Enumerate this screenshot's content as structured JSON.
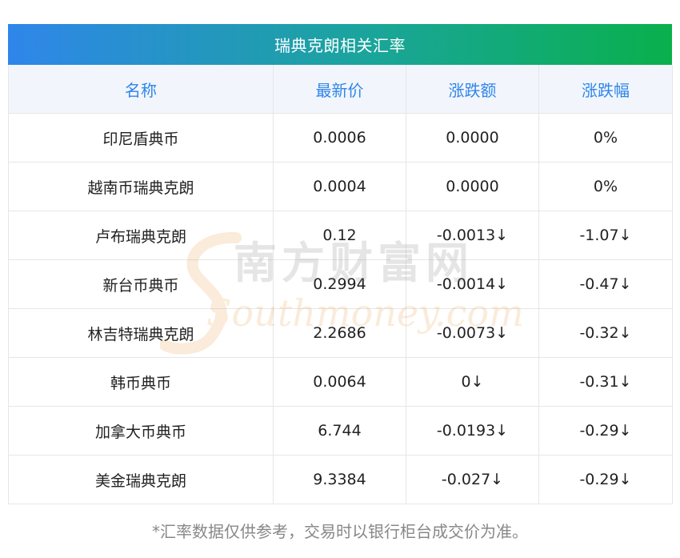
{
  "title": "瑞典克朗相关汇率",
  "columns": [
    "名称",
    "最新价",
    "涨跌额",
    "涨跌幅"
  ],
  "rows": [
    {
      "name": "印尼盾典币",
      "price": "0.0006",
      "change": "0.0000",
      "pct": "0%",
      "down": false
    },
    {
      "name": "越南币瑞典克朗",
      "price": "0.0004",
      "change": "0.0000",
      "pct": "0%",
      "down": false
    },
    {
      "name": "卢布瑞典克朗",
      "price": "0.12",
      "change": "-0.0013↓",
      "pct": "-1.07↓",
      "down": true
    },
    {
      "name": "新台币典币",
      "price": "0.2994",
      "change": "-0.0014↓",
      "pct": "-0.47↓",
      "down": true
    },
    {
      "name": "林吉特瑞典克朗",
      "price": "2.2686",
      "change": "-0.0073↓",
      "pct": "-0.32↓",
      "down": true
    },
    {
      "name": "韩币典币",
      "price": "0.0064",
      "change": "0↓",
      "pct": "-0.31↓",
      "down": true
    },
    {
      "name": "加拿大币典币",
      "price": "6.744",
      "change": "-0.0193↓",
      "pct": "-0.29↓",
      "down": true
    },
    {
      "name": "美金瑞典克朗",
      "price": "9.3384",
      "change": "-0.027↓",
      "pct": "-0.29↓",
      "down": true
    }
  ],
  "watermark": {
    "brand_cn": "南方财富网",
    "brand_en": "Southmoney.com"
  },
  "footnote": "*汇率数据仅供参考，交易时以银行柜台成交价为准。",
  "colors": {
    "header_start": "#2f86ea",
    "header_end": "#09b04c",
    "column_header_text": "#2f86ea",
    "down_text": "#109a10",
    "neutral_text": "#222222",
    "footnote_text": "#888888"
  }
}
